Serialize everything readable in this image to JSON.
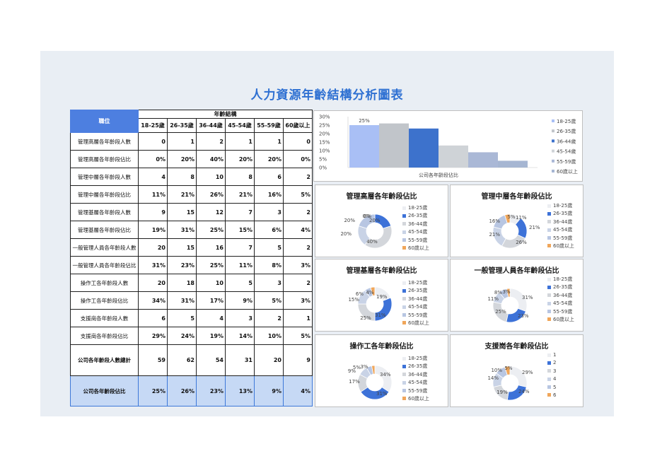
{
  "title": "人力資源年齡結構分析圖表",
  "table": {
    "post_header": "職位",
    "group_header": "年齡結構",
    "age_groups": [
      "18-25歲",
      "26-35歲",
      "36-44歲",
      "45-54歲",
      "55-59歲",
      "60歲以上"
    ],
    "rows": [
      {
        "label": "管理高層各年齡段人數",
        "cells": [
          "0",
          "1",
          "2",
          "1",
          "1",
          "0"
        ]
      },
      {
        "label": "管理高層各年齡段佔比",
        "cells": [
          "0%",
          "20%",
          "40%",
          "20%",
          "20%",
          "0%"
        ]
      },
      {
        "label": "管理中層各年齡段人數",
        "cells": [
          "4",
          "8",
          "10",
          "8",
          "6",
          "2"
        ]
      },
      {
        "label": "管理中層各年齡段佔比",
        "cells": [
          "11%",
          "21%",
          "26%",
          "21%",
          "16%",
          "5%"
        ]
      },
      {
        "label": "管理基層各年齡段人數",
        "cells": [
          "9",
          "15",
          "12",
          "7",
          "3",
          "2"
        ]
      },
      {
        "label": "管理基層各年齡段佔比",
        "cells": [
          "19%",
          "31%",
          "25%",
          "15%",
          "6%",
          "4%"
        ]
      },
      {
        "label": "一般管理人員各年齡段人數",
        "cells": [
          "20",
          "15",
          "16",
          "7",
          "5",
          "2"
        ]
      },
      {
        "label": "一般管理人員各年齡段佔比",
        "cells": [
          "31%",
          "23%",
          "25%",
          "11%",
          "8%",
          "3%"
        ]
      },
      {
        "label": "操作工各年齡段人數",
        "cells": [
          "20",
          "18",
          "10",
          "5",
          "3",
          "2"
        ]
      },
      {
        "label": "操作工各年齡段佔比",
        "cells": [
          "34%",
          "31%",
          "17%",
          "9%",
          "5%",
          "3%"
        ]
      },
      {
        "label": "支援崗各年齡段人數",
        "cells": [
          "6",
          "5",
          "4",
          "3",
          "2",
          "1"
        ]
      },
      {
        "label": "支援崗各年齡段佔比",
        "cells": [
          "29%",
          "24%",
          "19%",
          "14%",
          "10%",
          "5%"
        ]
      }
    ],
    "total_row": {
      "label": "公司各年齡段人數總計",
      "cells": [
        "59",
        "62",
        "54",
        "31",
        "20",
        "9"
      ]
    },
    "company_row": {
      "label": "公司各年齡段佔比",
      "cells": [
        "25%",
        "26%",
        "23%",
        "13%",
        "9%",
        "4%"
      ]
    }
  },
  "chart_data": [
    {
      "type": "bar",
      "title": "",
      "xlabel": "公司各年齡段佔比",
      "ylabel": "",
      "ylim": [
        0,
        30
      ],
      "y_ticks": [
        "0%",
        "5%",
        "10%",
        "15%",
        "20%",
        "25%",
        "30%"
      ],
      "categories": [
        "18-25歲",
        "26-35歲",
        "36-44歲",
        "45-54歲",
        "55-59歲",
        "60歲以上"
      ],
      "values": [
        25,
        26,
        23,
        13,
        9,
        4
      ],
      "data_labels": [
        "25%",
        "",
        "",
        "",
        "",
        ""
      ],
      "colors": [
        "#a9bff5",
        "#c1c5ca",
        "#3d72cc",
        "#cfd3d7",
        "#aab8d6",
        "#a6b6d2"
      ],
      "legend": {
        "position": "right",
        "entries": [
          "18-25歲",
          "26-35歲",
          "36-44歲",
          "45-54歲",
          "55-59歲",
          "60歲以上"
        ]
      }
    },
    {
      "type": "pie",
      "title": "管理高層各年齡段佔比",
      "categories": [
        "18-25歲",
        "26-35歲",
        "36-44歲",
        "45-54歲",
        "55-59歲",
        "60歲以上"
      ],
      "values": [
        0,
        20,
        40,
        20,
        20,
        0
      ],
      "data_labels": [
        "0%",
        "20%",
        "40%",
        "20%",
        "20%",
        "0%"
      ],
      "colors": [
        "#eceef2",
        "#3d72d8",
        "#d3d6db",
        "#c9d3e6",
        "#b8c6e2",
        "#f0a65a"
      ],
      "legend": {
        "position": "right",
        "entries": [
          "18-25歲",
          "26-35歲",
          "36-44歲",
          "45-54歲",
          "55-59歲",
          "60歲以上"
        ]
      }
    },
    {
      "type": "pie",
      "title": "管理中層各年齡段佔比",
      "categories": [
        "18-25歲",
        "26-35歲",
        "36-44歲",
        "45-54歲",
        "55-59歲",
        "60歲以上"
      ],
      "values": [
        11,
        21,
        26,
        21,
        16,
        5
      ],
      "data_labels": [
        "11%",
        "21%",
        "26%",
        "21%",
        "16%",
        "5%"
      ],
      "colors": [
        "#eceef2",
        "#3d72d8",
        "#d3d6db",
        "#c9d3e6",
        "#b8c6e2",
        "#f0a65a"
      ],
      "legend": {
        "position": "right",
        "entries": [
          "18-25歲",
          "26-35歲",
          "36-44歲",
          "45-54歲",
          "55-59歲",
          "60歲以上"
        ]
      }
    },
    {
      "type": "pie",
      "title": "管理基層各年齡段佔比",
      "categories": [
        "18-25歲",
        "26-35歲",
        "36-44歲",
        "45-54歲",
        "55-59歲",
        "60歲以上"
      ],
      "values": [
        19,
        31,
        25,
        15,
        6,
        4
      ],
      "data_labels": [
        "19%",
        "31%",
        "25%",
        "15%",
        "6%",
        "4%"
      ],
      "colors": [
        "#eceef2",
        "#3d72d8",
        "#d3d6db",
        "#c9d3e6",
        "#b8c6e2",
        "#f0a65a"
      ],
      "legend": {
        "position": "right",
        "entries": [
          "18-25歲",
          "26-35歲",
          "36-44歲",
          "45-54歲",
          "55-59歲",
          "60歲以上"
        ]
      }
    },
    {
      "type": "pie",
      "title": "一般管理人員各年齡段佔比",
      "categories": [
        "18-25歲",
        "26-35歲",
        "36-44歲",
        "45-54歲",
        "55-59歲",
        "60歲以上"
      ],
      "values": [
        31,
        23,
        25,
        11,
        8,
        3
      ],
      "data_labels": [
        "31%",
        "23%",
        "25%",
        "11%",
        "8%",
        "3%"
      ],
      "colors": [
        "#eceef2",
        "#3d72d8",
        "#d3d6db",
        "#c9d3e6",
        "#b8c6e2",
        "#f0a65a"
      ],
      "legend": {
        "position": "right",
        "entries": [
          "18-25歲",
          "26-35歲",
          "36-44歲",
          "45-54歲",
          "55-59歲",
          "60歲以上"
        ]
      }
    },
    {
      "type": "pie",
      "title": "操作工各年齡段佔比",
      "categories": [
        "18-25歲",
        "26-35歲",
        "36-44歲",
        "45-54歲",
        "55-59歲",
        "60歲以上"
      ],
      "values": [
        34,
        31,
        17,
        9,
        5,
        3
      ],
      "data_labels": [
        "34%",
        "31%",
        "17%",
        "9%",
        "5%",
        "3%"
      ],
      "colors": [
        "#eceef2",
        "#3d72d8",
        "#d3d6db",
        "#c9d3e6",
        "#b8c6e2",
        "#f0a65a"
      ],
      "legend": {
        "position": "right",
        "entries": [
          "18-25歲",
          "26-35歲",
          "36-44歲",
          "45-54歲",
          "55-59歲",
          "60歲以上"
        ]
      }
    },
    {
      "type": "pie",
      "title": "支援崗各年齡段佔比",
      "categories": [
        "1",
        "2",
        "3",
        "4",
        "5",
        "6"
      ],
      "values": [
        29,
        24,
        19,
        14,
        10,
        5
      ],
      "data_labels": [
        "29%",
        "24%",
        "19%",
        "14%",
        "10%",
        "5%"
      ],
      "colors": [
        "#eceef2",
        "#3d72d8",
        "#d3d6db",
        "#c9d3e6",
        "#b8c6e2",
        "#f0a65a"
      ],
      "legend": {
        "position": "right",
        "entries": [
          "1",
          "2",
          "3",
          "4",
          "5",
          "6"
        ]
      }
    }
  ]
}
